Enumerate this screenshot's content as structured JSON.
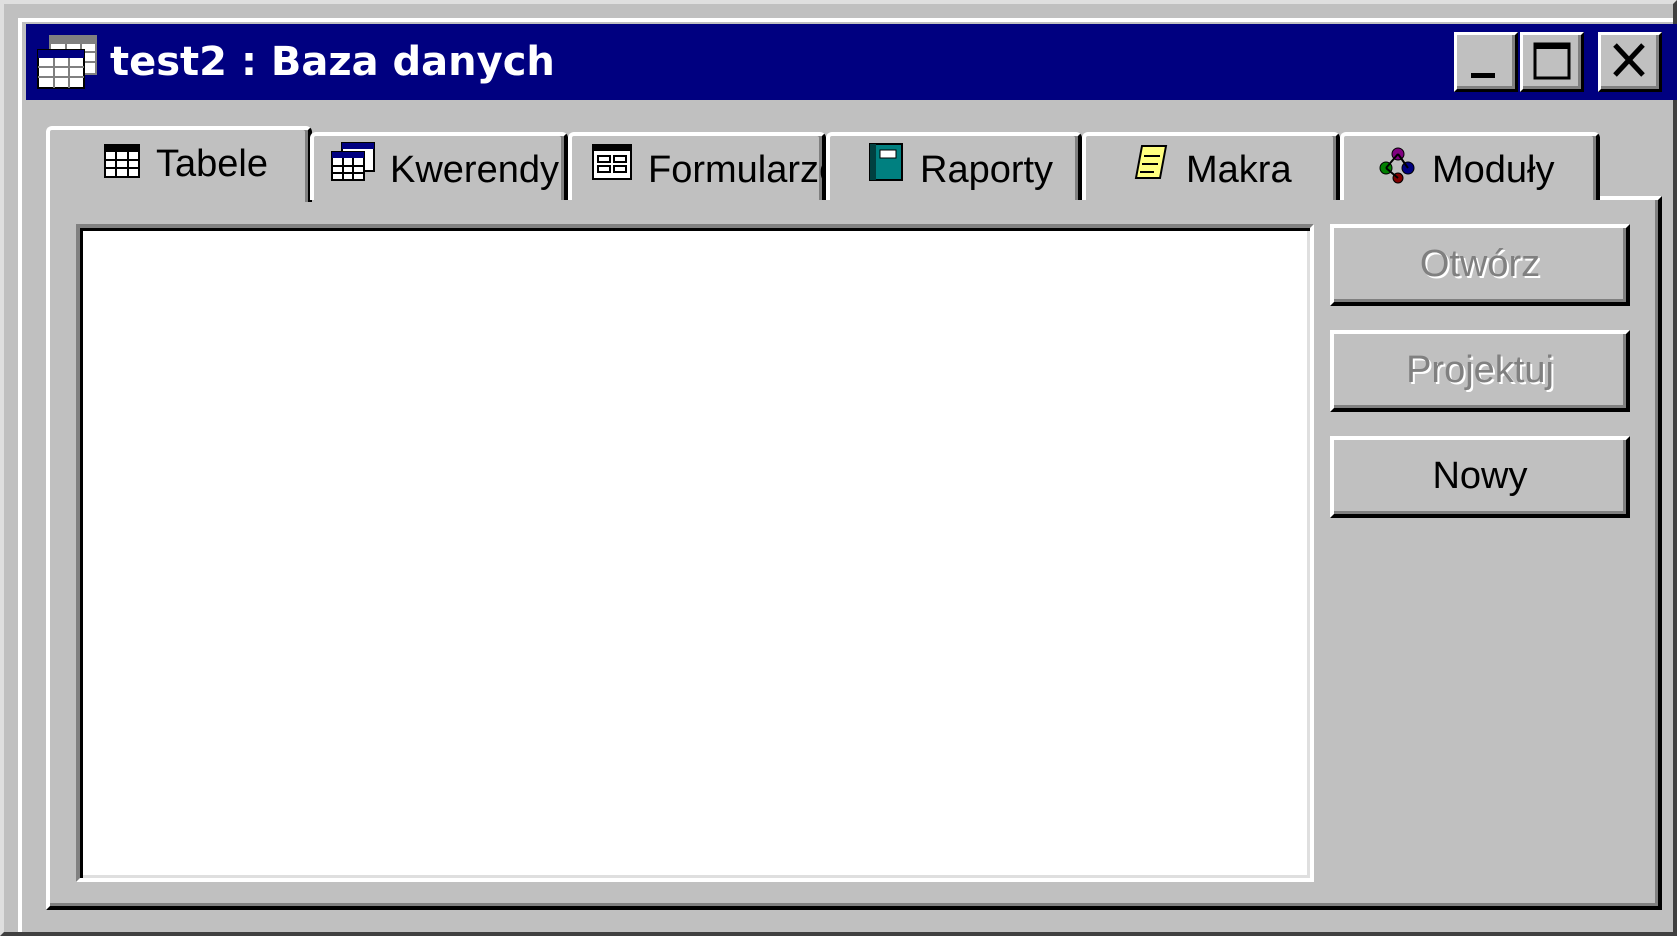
{
  "window": {
    "title": "test2 : Baza danych",
    "controls": {
      "minimize_icon": "minimize-icon",
      "maximize_icon": "maximize-icon",
      "close_icon": "close-icon"
    }
  },
  "tabs": [
    {
      "label": "Tabele",
      "icon": "table-icon",
      "active": true
    },
    {
      "label": "Kwerendy",
      "icon": "query-icon",
      "active": false
    },
    {
      "label": "Formularze",
      "icon": "form-icon",
      "active": false
    },
    {
      "label": "Raporty",
      "icon": "report-icon",
      "active": false
    },
    {
      "label": "Makra",
      "icon": "macro-icon",
      "active": false
    },
    {
      "label": "Moduły",
      "icon": "module-icon",
      "active": false
    }
  ],
  "buttons": {
    "open": {
      "label": "Otwórz",
      "enabled": false
    },
    "design": {
      "label": "Projektuj",
      "enabled": false
    },
    "new": {
      "label": "Nowy",
      "enabled": true
    }
  },
  "colors": {
    "titlebar": "#000080",
    "face": "#c0c0c0",
    "list_background": "#ffffff"
  }
}
